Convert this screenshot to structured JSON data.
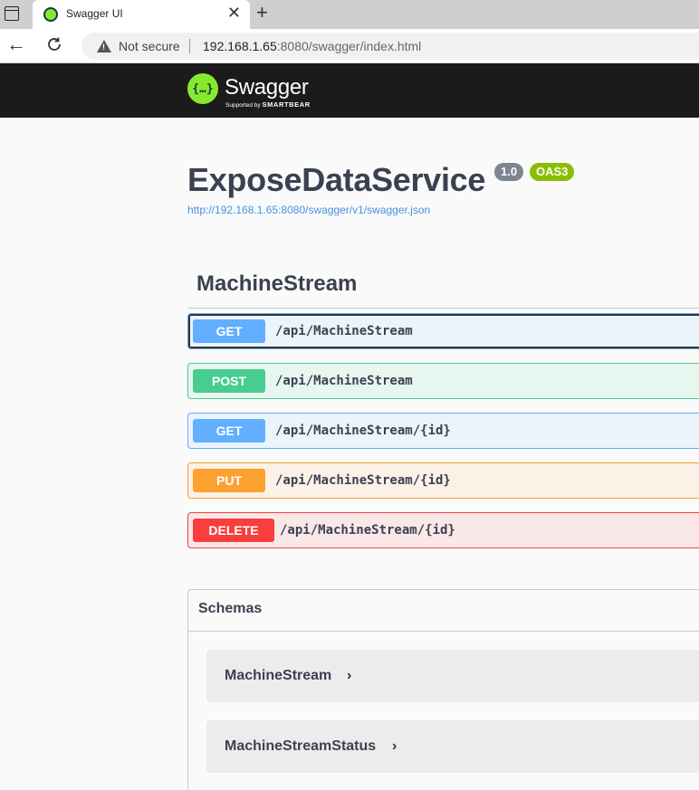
{
  "browser": {
    "tab_title": "Swagger UI",
    "security_label": "Not secure",
    "url_host": "192.168.1.65",
    "url_rest": ":8080/swagger/index.html"
  },
  "topbar": {
    "logo_mark": "{…}",
    "logo_word": "Swagger",
    "logo_sub_prefix": "Supported by ",
    "logo_sub_brand": "SMARTBEAR"
  },
  "info": {
    "title": "ExposeDataService",
    "version": "1.0",
    "oas": "OAS3",
    "spec_url": "http://192.168.1.65:8080/swagger/v1/swagger.json"
  },
  "tag": {
    "name": "MachineStream",
    "operations": [
      {
        "method": "GET",
        "path": "/api/MachineStream"
      },
      {
        "method": "POST",
        "path": "/api/MachineStream"
      },
      {
        "method": "GET",
        "path": "/api/MachineStream/{id}"
      },
      {
        "method": "PUT",
        "path": "/api/MachineStream/{id}"
      },
      {
        "method": "DELETE",
        "path": "/api/MachineStream/{id}"
      }
    ]
  },
  "schemas": {
    "title": "Schemas",
    "models": [
      {
        "name": "MachineStream"
      },
      {
        "name": "MachineStreamStatus"
      }
    ]
  },
  "colors": {
    "get": "#61affe",
    "post": "#49cc90",
    "put": "#fca130",
    "delete": "#f93e3e",
    "swagger_green": "#85ea2d",
    "topbar": "#1b1b1b"
  }
}
